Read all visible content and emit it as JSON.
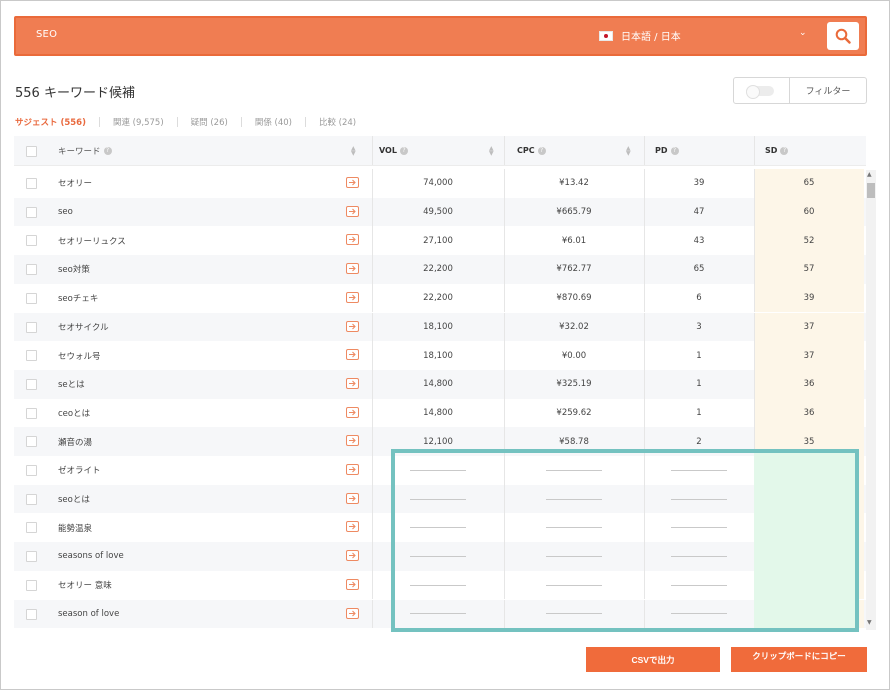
{
  "search": {
    "query": "SEO",
    "language": "日本語 / 日本",
    "flag_icon": "japan-flag-icon",
    "search_icon": "search-icon"
  },
  "heading": {
    "count_title": "556 キーワード候補",
    "filter_label": "フィルター"
  },
  "tabs": [
    {
      "label": "サジェスト (556)",
      "active": true
    },
    {
      "label": "関連 (9,575)",
      "active": false
    },
    {
      "label": "疑問 (26)",
      "active": false
    },
    {
      "label": "関係 (40)",
      "active": false
    },
    {
      "label": "比較 (24)",
      "active": false
    }
  ],
  "table": {
    "columns": {
      "keyword": "キーワード",
      "vol": "VOL",
      "cpc": "CPC",
      "pd": "PD",
      "sd": "SD"
    },
    "rows": [
      {
        "keyword": "セオリー",
        "vol": "74,000",
        "cpc": "¥13.42",
        "pd": "39",
        "sd": "65"
      },
      {
        "keyword": "seo",
        "vol": "49,500",
        "cpc": "¥665.79",
        "pd": "47",
        "sd": "60"
      },
      {
        "keyword": "セオリーリュクス",
        "vol": "27,100",
        "cpc": "¥6.01",
        "pd": "43",
        "sd": "52"
      },
      {
        "keyword": "seo対策",
        "vol": "22,200",
        "cpc": "¥762.77",
        "pd": "65",
        "sd": "57"
      },
      {
        "keyword": "seoチェキ",
        "vol": "22,200",
        "cpc": "¥870.69",
        "pd": "6",
        "sd": "39"
      },
      {
        "keyword": "セオサイクル",
        "vol": "18,100",
        "cpc": "¥32.02",
        "pd": "3",
        "sd": "37"
      },
      {
        "keyword": "セウォル号",
        "vol": "18,100",
        "cpc": "¥0.00",
        "pd": "1",
        "sd": "37"
      },
      {
        "keyword": "seとは",
        "vol": "14,800",
        "cpc": "¥325.19",
        "pd": "1",
        "sd": "36"
      },
      {
        "keyword": "ceoとは",
        "vol": "14,800",
        "cpc": "¥259.62",
        "pd": "1",
        "sd": "36"
      },
      {
        "keyword": "瀬音の湯",
        "vol": "12,100",
        "cpc": "¥58.78",
        "pd": "2",
        "sd": "35"
      },
      {
        "keyword": "ゼオライト",
        "vol": "",
        "cpc": "",
        "pd": "",
        "sd": ""
      },
      {
        "keyword": "seoとは",
        "vol": "",
        "cpc": "",
        "pd": "",
        "sd": ""
      },
      {
        "keyword": "能勢温泉",
        "vol": "",
        "cpc": "",
        "pd": "",
        "sd": ""
      },
      {
        "keyword": "seasons of love",
        "vol": "",
        "cpc": "",
        "pd": "",
        "sd": ""
      },
      {
        "keyword": "セオリー 意味",
        "vol": "",
        "cpc": "",
        "pd": "",
        "sd": ""
      },
      {
        "keyword": "season of love",
        "vol": "",
        "cpc": "",
        "pd": "",
        "sd": ""
      }
    ]
  },
  "buttons": {
    "csv": "CSVで出力",
    "clipboard": "クリップボードにコピー"
  },
  "colors": {
    "accent": "#f07d52",
    "highlight": "#74c2c0",
    "sd_column": "#fdf6e8"
  }
}
